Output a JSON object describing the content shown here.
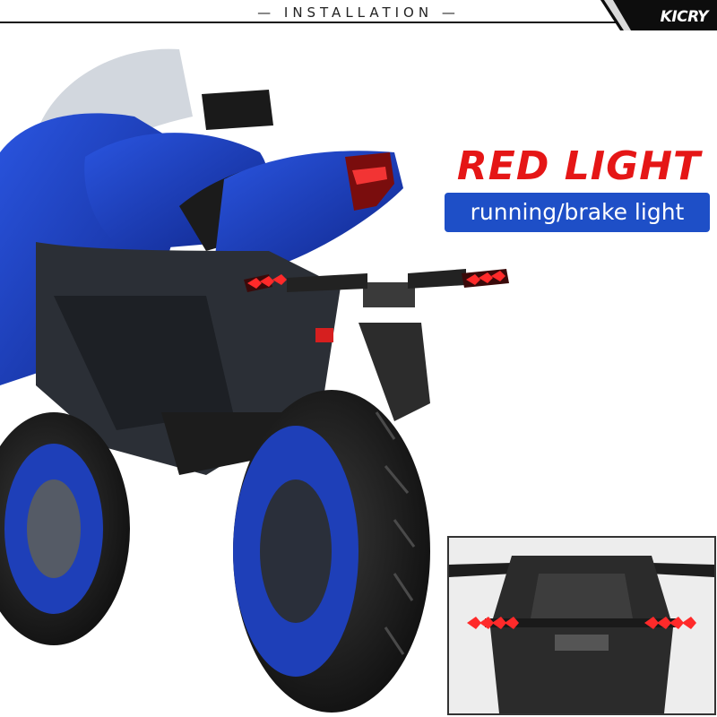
{
  "header": {
    "title": "INSTALLATION",
    "left_dash": "—",
    "right_dash": "—"
  },
  "brand": {
    "logo_text": "KICRY"
  },
  "feature": {
    "title": "RED LIGHT",
    "subtitle": "running/brake light"
  },
  "colors": {
    "title_red": "#e51616",
    "pill_blue": "#1e4fc7",
    "bike_blue": "#1a3fc0",
    "light_red": "#ff2a2a"
  }
}
